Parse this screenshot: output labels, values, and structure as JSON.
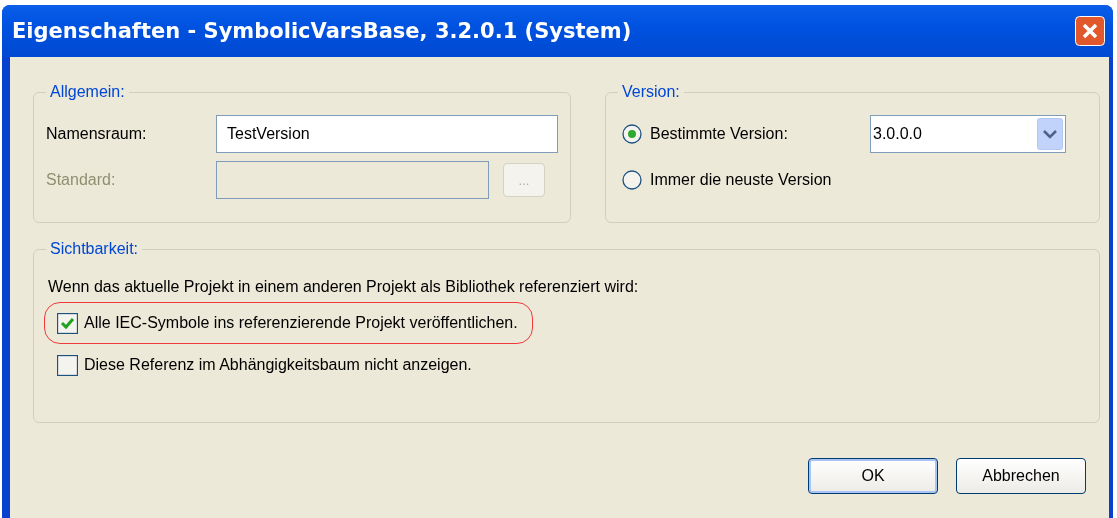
{
  "window": {
    "title": "Eigenschaften - SymbolicVarsBase, 3.2.0.1 (System)"
  },
  "general": {
    "title": "Allgemein:",
    "fields": [
      {
        "label": "Namensraum:",
        "value": "TestVersion",
        "disabled": false
      },
      {
        "label": "Standard:",
        "disabled": true,
        "button": "..."
      }
    ]
  },
  "version": {
    "title": "Version:",
    "options": [
      {
        "label": "Bestimmte Version:",
        "selected": true,
        "dropdown": "3.0.0.0"
      },
      {
        "label": "Immer die neuste Version",
        "selected": false
      }
    ]
  },
  "visibility": {
    "title": "Sichtbarkeit:",
    "text": "Wenn das aktuelle Projekt in einem anderen Projekt als Bibliothek referenziert wird:",
    "options": [
      {
        "label": "Alle IEC-Symbole ins referenzierende Projekt veröffentlichen.",
        "checked": true,
        "highlighted": true
      },
      {
        "label": "Diese Referenz im Abhängigkeitsbaum nicht anzeigen.",
        "checked": false,
        "highlighted": false
      }
    ]
  },
  "buttons": [
    {
      "label": "OK",
      "default": true
    },
    {
      "label": "Abbrechen",
      "default": false
    }
  ]
}
